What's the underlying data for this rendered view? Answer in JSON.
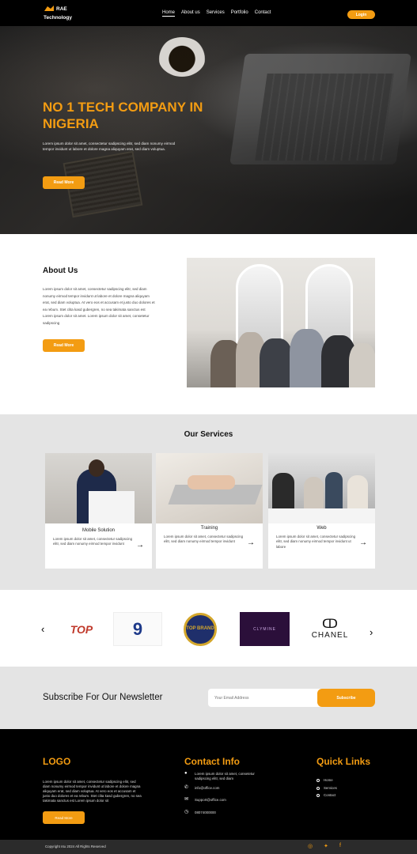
{
  "nav": {
    "brand_name": "RAE",
    "brand_sub": "Technology",
    "links": [
      "Home",
      "About us",
      "Services",
      "Portfolio",
      "Contact"
    ],
    "login": "Login"
  },
  "hero": {
    "title": "NO 1 TECH COMPANY IN NIGERIA",
    "text": "Lorem ipsum dolor sit amet, consectetur sadipscing elitr, sed diam nonumy eirmod tempor invidunt ut labore et dolore magna aliquyam erat, sed diam voluptua.",
    "button": "Read More",
    "slide_active": 1,
    "slide_count": 4
  },
  "about": {
    "title": "About Us",
    "text": "Lorem ipsum dolor sit amet, consectetur sadipscing elitr, sed diam nonumy eirmod tempor invidunt ut labore et dolore magna aliquyam erat, sed diam voluptua. At vero eos et accusam et justo duo dolores et ea rebum. Stet clita kasd gubergren, no sea takimata sanctus est Lorem ipsum dolor sit amet. Lorem ipsum dolor sit amet, consetetur sadipscing",
    "button": "Read More"
  },
  "services": {
    "title": "Our Services",
    "cards": [
      {
        "title": "Mobile Solution",
        "text": "Lorem ipsum dolor sit amet, consectetur sadipscing elitr, sed diam nonumy eirmod tempor invidunt"
      },
      {
        "title": "Training",
        "text": "Lorem ipsum dolor sit amet, consectetur sadipscing elitr, sed diam nonumy eirmod tempor invidunt"
      },
      {
        "title": "Web",
        "text": "Lorem ipsum dolor sit amet, consectetur sadipscing elitr, sed diam nonumy eirmod tempor invidunt ut labore"
      }
    ]
  },
  "brands": {
    "logos": [
      "TOP",
      "9",
      "TOP BRAND",
      "CLYMINE",
      "CHANEL"
    ]
  },
  "newsletter": {
    "title": "Subscribe For Our Newsletter",
    "placeholder": "Your Email Address",
    "button": "Subscribe"
  },
  "footer": {
    "logo_head": "LOGO",
    "logo_text": "Lorem ipsum dolor sit amet, consectetur sadipscing elitr, sed diam nonumy eirmod tempor invidunt ut labore et dolore magna aliquyam erat, sed diam voluptua. At vero eos et accusam et justo duo dolores et ea rebum. Stet clita kasd gubergren, no sea takimata sanctus est Lorem ipsum dolor sit",
    "logo_button": "Read More",
    "contact_head": "Contact Info",
    "contact": [
      "Lorem ipsum dolor sit amet, consetetur sadipscing elitr, sed diam",
      "info@office.com",
      "Support@office.com",
      "08074000000"
    ],
    "links_head": "Quick Links",
    "links": [
      "Home",
      "Services",
      "Contact"
    ],
    "copyright": "Copyright ntu 2024 All Rights Reserved"
  },
  "colors": {
    "accent": "#f39c12",
    "dark": "#000000",
    "light_band": "#e4e4e4"
  }
}
